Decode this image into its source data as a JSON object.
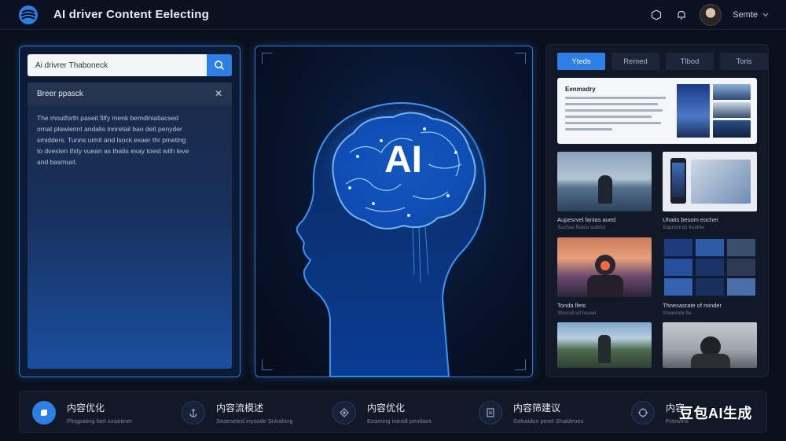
{
  "header": {
    "title": "AI driver Content Eelecting",
    "user_name": "Semte",
    "icons": [
      "hexagon-icon",
      "bell-icon",
      "chevron-down-icon"
    ]
  },
  "left": {
    "search": {
      "value": "Ai drivrer Thaboneck"
    },
    "result": {
      "heading": "Breer ppasck",
      "lines": [
        "The moutforth paseit filfy menk bemdiniatiacsed",
        "ornat plawlennt andalis innretail bao deit penyder",
        "smidders. Tunns uimit and lsock exaer thr pmeting",
        "to dvesten thity vuean as thatis exay toest with leve",
        "and basmust."
      ]
    }
  },
  "center": {
    "ai_label": "AI"
  },
  "right": {
    "tabs": [
      "Yteds",
      "Remed",
      "Tlbod",
      "Toris"
    ],
    "feature_title": "Eenmadry",
    "grid": [
      {
        "caption": "Aupesrvel fanlas aued",
        "sub": "Suchas Ndesl sulbhd"
      },
      {
        "caption": "Uhaits besom eocher",
        "sub": "Sapnonrds lnudhe"
      },
      {
        "caption": "Tonda flets",
        "sub": "Shocsfi sd fuseel"
      },
      {
        "caption": "Thnesasrate of minder",
        "sub": "Shaemde fle"
      },
      {
        "caption": "",
        "sub": ""
      },
      {
        "caption": "",
        "sub": ""
      }
    ]
  },
  "bottom": {
    "features": [
      {
        "title": "内容优化",
        "sub": "Plogpating fael iuraotinet"
      },
      {
        "title": "内容流模述",
        "sub": "Seaeseted inysode Snirahing"
      },
      {
        "title": "内容优化",
        "sub": "Eeaming iranidl peotlaes"
      },
      {
        "title": "内容筛建议",
        "sub": "Gebaidon peort Shaldeoes"
      },
      {
        "title": "内容",
        "sub": "Frenvlns"
      }
    ],
    "watermark": "豆包AI生成"
  },
  "colors": {
    "accent": "#2d7fe6",
    "background": "#0a0f1c",
    "panel": "#111827"
  }
}
